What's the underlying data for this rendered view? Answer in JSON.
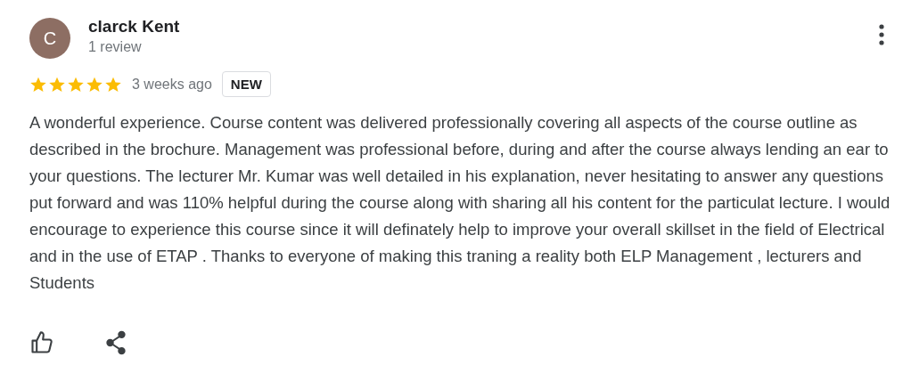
{
  "review": {
    "avatar_letter": "C",
    "author": "clarck Kent",
    "author_meta": "1 review",
    "stars": 5,
    "time": "3 weeks ago",
    "badge": "NEW",
    "text": "A wonderful experience. Course content was delivered professionally covering all aspects of the course outline as described in the brochure. Management was professional before, during and after the course always lending an ear to your questions. The lecturer Mr. Kumar was well detailed in his explanation, never hesitating to answer any questions put forward and was 110% helpful during the course along with sharing all his content for the particulat lecture. I would encourage to experience this course since it will definately help to improve your overall skillset in the field of Electrical and in the use of ETAP . Thanks to everyone of making this traning a reality both ELP Management , lecturers and Students"
  }
}
